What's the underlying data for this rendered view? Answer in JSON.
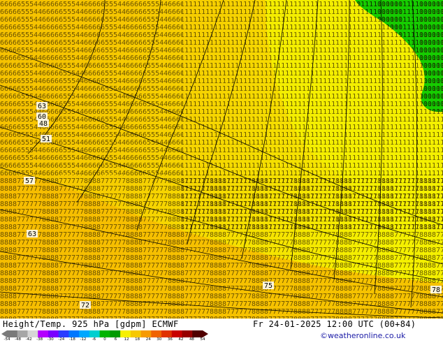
{
  "map": {
    "contour_labels": [
      "63",
      "60",
      "48",
      "51",
      "57",
      "63",
      "75",
      "72",
      "78"
    ],
    "colors": {
      "yellow": "#f4f000",
      "orange": "#f6bb00",
      "green": "#16cc00",
      "digit_dark": "#3a2a00",
      "digit_green": "#002a00"
    }
  },
  "footer": {
    "title": "Height/Temp. 925 hPa [gdpm] ECMWF",
    "datetime": "Fr 24-01-2025 12:00 UTC (00+84)",
    "copyright": "©weatheronline.co.uk",
    "colorbar_ticks": [
      "-54",
      "-48",
      "-42",
      "-38",
      "-30",
      "-24",
      "-18",
      "-12",
      "-6",
      "0",
      "6",
      "12",
      "18",
      "24",
      "30",
      "36",
      "42",
      "48",
      "54"
    ],
    "colorbar_colors": [
      "#7a7a7a",
      "#a6a6a6",
      "#d6d6d6",
      "#b400ff",
      "#7a00ff",
      "#2a3cff",
      "#0077ff",
      "#00a7ff",
      "#00cfd0",
      "#00b400",
      "#009a00",
      "#f6f000",
      "#f6c800",
      "#f69a00",
      "#f06400",
      "#e03200",
      "#c80000",
      "#960000",
      "#500000"
    ]
  }
}
